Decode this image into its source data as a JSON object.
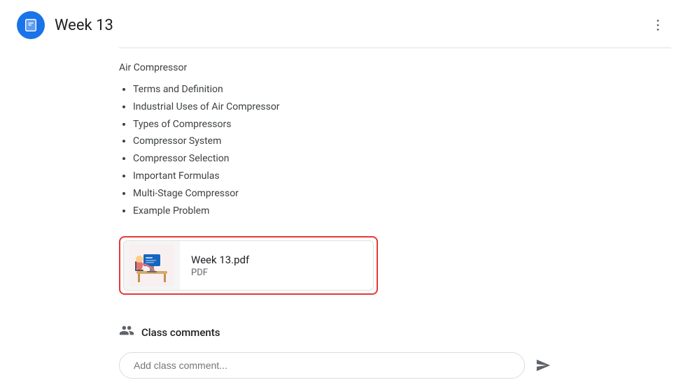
{
  "header": {
    "title": "Week 13",
    "icon_label": "classroom-icon",
    "more_icon": "more-vert-icon"
  },
  "content": {
    "section_label": "Air Compressor",
    "bullet_items": [
      "Terms and Definition",
      "Industrial Uses of Air Compressor",
      "Types of Compressors",
      "Compressor System",
      "Compressor Selection",
      "Important Formulas",
      "Multi-Stage Compressor",
      "Example Problem"
    ],
    "pdf": {
      "filename": "Week 13.pdf",
      "type_label": "PDF"
    }
  },
  "comments": {
    "section_title": "Class comments",
    "input_placeholder": "Add class comment..."
  }
}
